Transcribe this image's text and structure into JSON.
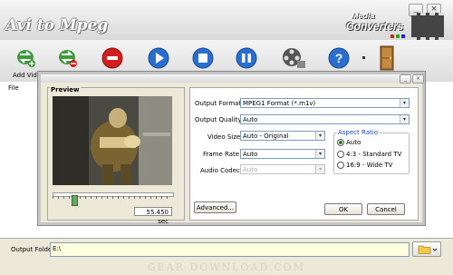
{
  "app": {
    "title": "Avi to Mpeg",
    "brand_line1": "Media",
    "brand_line2": "Converters"
  },
  "window_buttons": {
    "minimize": "_",
    "close": "×"
  },
  "toolbar": {
    "add_video_label": "Add Video",
    "icons": [
      "add-video-icon",
      "remove-video-icon",
      "stop-icon",
      "play-icon",
      "record-icon",
      "pause-icon",
      "film-settings-icon",
      "help-icon",
      "exit-door-icon"
    ]
  },
  "file_list": {
    "header": "File"
  },
  "output": {
    "label": "Output Folder",
    "path": "E:\\"
  },
  "watermark": "GEAR DOWNLOAD.COM",
  "dialog": {
    "preview_label": "Preview",
    "time": "55.450 sec",
    "fields": {
      "output_format": {
        "label": "Output Format",
        "value": "MPEG1 Format (*.m1v)"
      },
      "output_quality": {
        "label": "Output Quality",
        "value": "Auto"
      },
      "video_size": {
        "label": "Video Size",
        "value": "Auto - Original"
      },
      "frame_rate": {
        "label": "Frame Rate",
        "value": "Auto"
      },
      "audio_codec": {
        "label": "Audio Codec",
        "value": "Auto"
      }
    },
    "aspect_ratio": {
      "label": "Aspect Ratio",
      "options": [
        "Auto",
        "4:3 - Standard TV",
        "16:9 - Wide TV"
      ],
      "selected": "Auto"
    },
    "buttons": {
      "advanced": "Advanced...",
      "ok": "OK",
      "cancel": "Cancel"
    }
  },
  "colors": {
    "accent_blue": "#1e46b4",
    "stop_red": "#d21e1e",
    "play_blue": "#2a6fd0",
    "output_field": "#ffffe0"
  }
}
